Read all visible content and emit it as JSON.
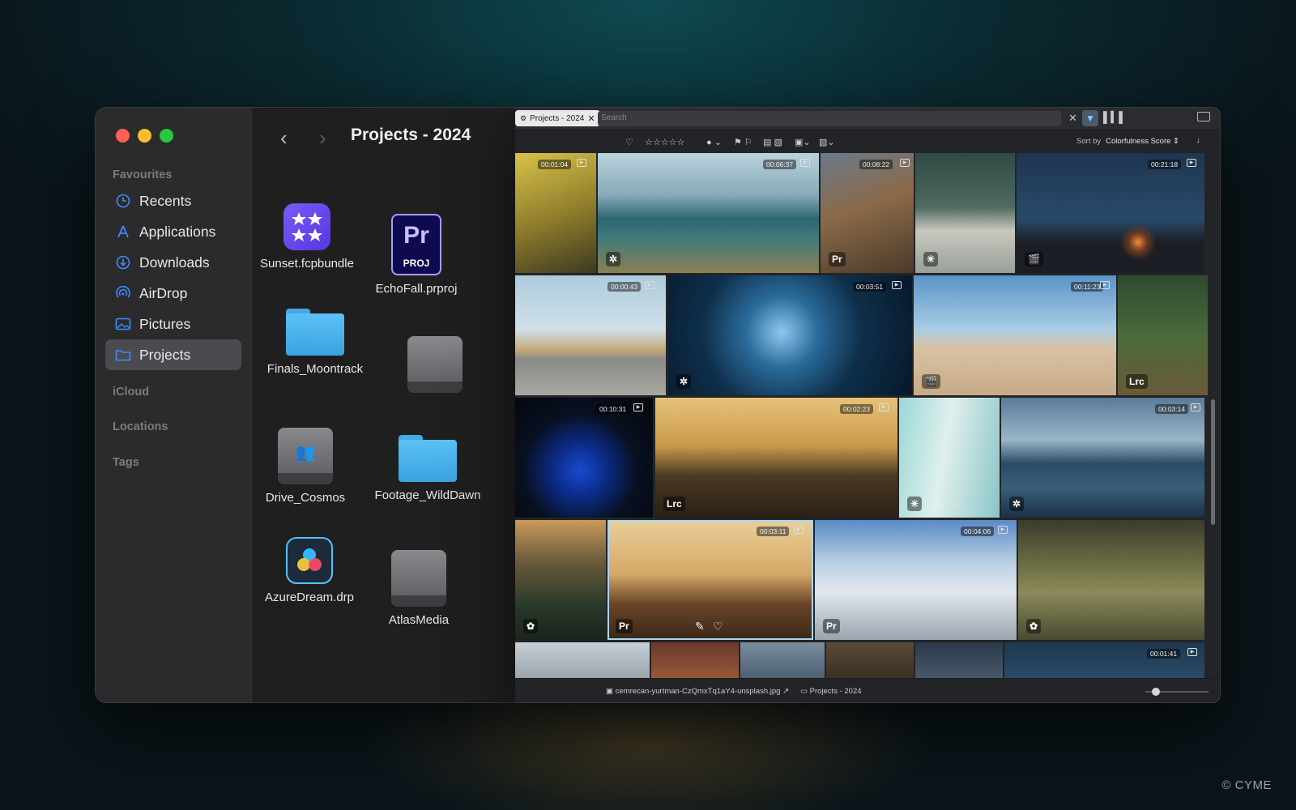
{
  "watermark": "© CYME",
  "finder": {
    "title": "Projects - 2024",
    "sidebar": {
      "favourites_label": "Favourites",
      "items": [
        {
          "label": "Recents",
          "icon": "clock-icon"
        },
        {
          "label": "Applications",
          "icon": "applications-icon"
        },
        {
          "label": "Downloads",
          "icon": "download-icon"
        },
        {
          "label": "AirDrop",
          "icon": "airdrop-icon"
        },
        {
          "label": "Pictures",
          "icon": "pictures-icon"
        },
        {
          "label": "Projects",
          "icon": "folder-icon",
          "active": true
        }
      ],
      "icloud_label": "iCloud",
      "locations_label": "Locations",
      "tags_label": "Tags"
    },
    "files": [
      {
        "name": "Sunset.fcpbundle",
        "icon": "fcp-bundle-icon"
      },
      {
        "name": "EchoFall.prproj",
        "icon": "premiere-project-icon"
      },
      {
        "name": "Finals_Moontrack",
        "icon": "folder-icon"
      },
      {
        "name": "",
        "icon": "drive-icon"
      },
      {
        "name": "Drive_Cosmos",
        "icon": "network-drive-icon"
      },
      {
        "name": "Footage_WildDawn",
        "icon": "folder-icon"
      },
      {
        "name": "AzureDream.drp",
        "icon": "davinci-resolve-icon"
      },
      {
        "name": "AtlasMedia",
        "icon": "drive-icon"
      }
    ],
    "pr_icon": {
      "top": "Pr",
      "bottom": "PROJ"
    }
  },
  "viewer": {
    "tab_label": "Projects - 2024",
    "search_placeholder": "Search",
    "sort_label": "Sort by",
    "sort_value": "Colorfulness Score ⇕",
    "status": {
      "filename": "cemrecan-yurtman-CzQmxTq1aY4-unsplash.jpg",
      "project": "Projects - 2024"
    },
    "tiles": [
      {
        "duration": "00:01:04",
        "badge": ""
      },
      {
        "duration": "00:06:37",
        "badge": "davinci-resolve-icon"
      },
      {
        "duration": "00:08:22",
        "badge": "Pr"
      },
      {
        "duration": "",
        "badge": "asterisk-icon"
      },
      {
        "duration": "00:21:18",
        "badge": "clapper-icon"
      },
      {
        "duration": "00:00:43",
        "badge": ""
      },
      {
        "duration": "00:03:51",
        "badge": "davinci-resolve-icon"
      },
      {
        "duration": "00:11:23",
        "badge": "clapper-icon"
      },
      {
        "duration": "",
        "badge": "Lrc"
      },
      {
        "duration": "00:10:31",
        "badge": ""
      },
      {
        "duration": "00:02:23",
        "badge": "Lrc"
      },
      {
        "duration": "",
        "badge": "asterisk-icon"
      },
      {
        "duration": "00:03:14",
        "badge": "davinci-resolve-icon"
      },
      {
        "duration": "",
        "badge": "flower-icon"
      },
      {
        "duration": "00:03:11",
        "badge": "Pr"
      },
      {
        "duration": "00:04:06",
        "badge": "Pr"
      },
      {
        "duration": "",
        "badge": "flower-icon"
      },
      {
        "duration": "00:01:41",
        "badge": ""
      }
    ]
  }
}
